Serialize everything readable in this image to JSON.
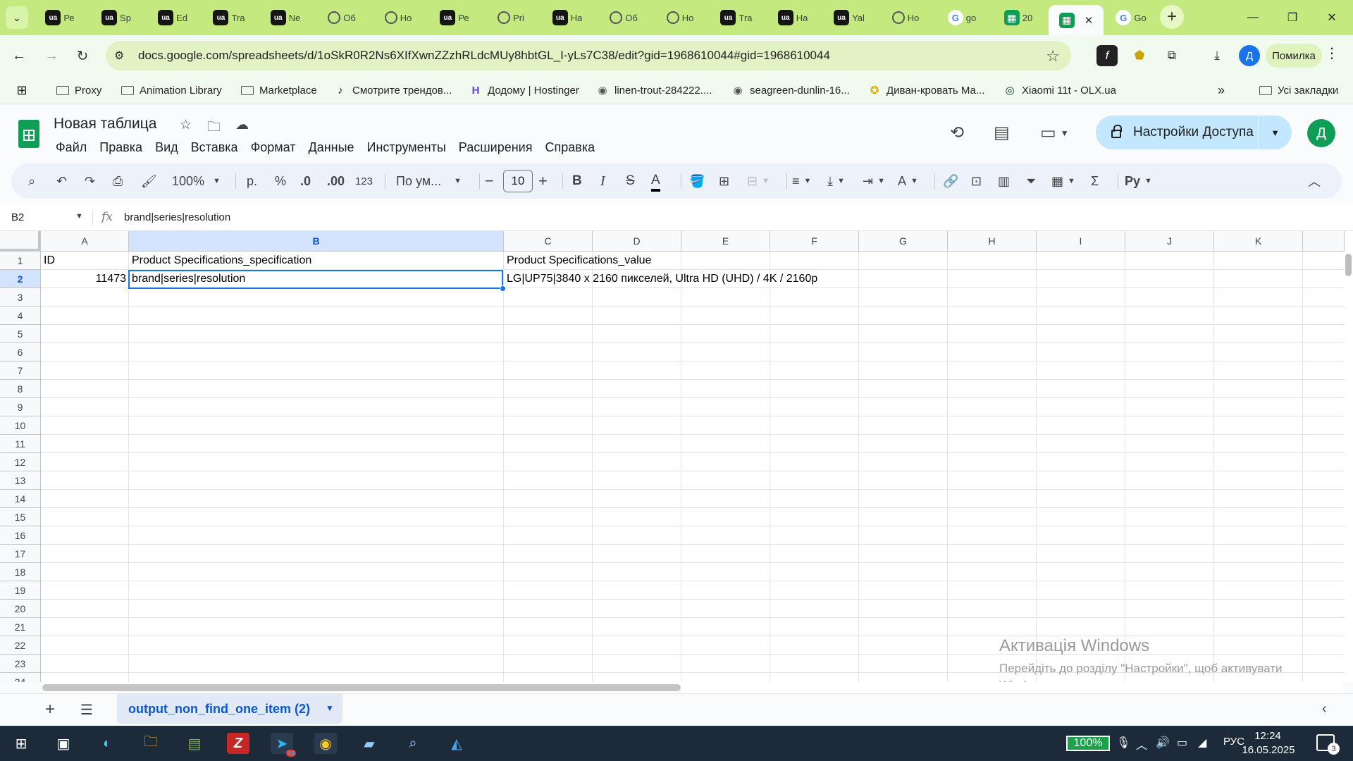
{
  "browser": {
    "tabs": [
      {
        "icon": "ua",
        "title": "Ре"
      },
      {
        "icon": "ua",
        "title": "Sp"
      },
      {
        "icon": "ua",
        "title": "Ed"
      },
      {
        "icon": "ua",
        "title": "Tra"
      },
      {
        "icon": "ua",
        "title": "Ne"
      },
      {
        "icon": "q",
        "title": "Об"
      },
      {
        "icon": "q",
        "title": "Но"
      },
      {
        "icon": "ua",
        "title": "Ре"
      },
      {
        "icon": "q",
        "title": "Pri"
      },
      {
        "icon": "ua",
        "title": "На"
      },
      {
        "icon": "q",
        "title": "Об"
      },
      {
        "icon": "q",
        "title": "Но"
      },
      {
        "icon": "ua",
        "title": "Tra"
      },
      {
        "icon": "ua",
        "title": "На"
      },
      {
        "icon": "ua",
        "title": "Yal"
      },
      {
        "icon": "q",
        "title": "Но"
      },
      {
        "icon": "g",
        "title": "go"
      },
      {
        "icon": "sheets",
        "title": "20"
      },
      {
        "icon": "sheets",
        "title": ""
      },
      {
        "icon": "g",
        "title": "Go"
      }
    ],
    "url": "docs.google.com/spreadsheets/d/1oSkR0R2Ns6XIfXwnZZzhRLdcMUy8hbtGL_I-yLs7C38/edit?gid=1968610044#gid=1968610044",
    "profile_letter": "Д",
    "error_label": "Помилка",
    "bookmarks": [
      {
        "icon": "folder",
        "label": "Proxy"
      },
      {
        "icon": "folder",
        "label": "Animation Library"
      },
      {
        "icon": "folder",
        "label": "Marketplace"
      },
      {
        "icon": "tiktok",
        "label": "Смотрите трендов..."
      },
      {
        "icon": "hostinger",
        "label": "Додому | Hostinger"
      },
      {
        "icon": "globe",
        "label": "linen-trout-284222...."
      },
      {
        "icon": "globe",
        "label": "seagreen-dunlin-16..."
      },
      {
        "icon": "medal",
        "label": "Диван-кровать Ма..."
      },
      {
        "icon": "olx",
        "label": "Xiaomi 11t - OLX.ua"
      }
    ],
    "all_bookmarks": "Усі закладки"
  },
  "sheets": {
    "title": "Новая таблица",
    "menus": [
      "Файл",
      "Правка",
      "Вид",
      "Вставка",
      "Формат",
      "Данные",
      "Инструменты",
      "Расширения",
      "Справка"
    ],
    "share_label": "Настройки Доступа",
    "account_letter": "Д",
    "toolbar": {
      "zoom": "100%",
      "currency": "р.",
      "percent": "%",
      "dec_decrease": ".0",
      "dec_increase": ".00",
      "number_format": "123",
      "font": "По ум...",
      "font_size": "10",
      "bold": "B",
      "italic": "I",
      "strike": "S",
      "text_color": "A"
    },
    "namebox": "B2",
    "fx_label": "fx",
    "formula": "brand|series|resolution",
    "columns": [
      "A",
      "B",
      "C",
      "D",
      "E",
      "F",
      "G",
      "H",
      "I",
      "J",
      "K"
    ],
    "selected_column": "B",
    "rows": [
      "1",
      "2",
      "3",
      "4",
      "5",
      "6",
      "7",
      "8",
      "9",
      "10",
      "11",
      "12",
      "13",
      "14",
      "15",
      "16",
      "17",
      "18",
      "19",
      "20",
      "21",
      "22",
      "23",
      "24"
    ],
    "selected_row": "2",
    "cells": {
      "A1": "ID",
      "B1": "Product Specifications_specification",
      "C1": "Product Specifications_value",
      "A2": "11473",
      "B2": "brand|series|resolution",
      "C2": "LG|UP75|3840 x 2160 пикселей, Ultra HD (UHD) / 4K / 2160p"
    },
    "sheet_tab": "output_non_find_one_item (2)",
    "watermark_title": "Активація Windows",
    "watermark_sub": "Перейдіть до розділу \"Настройки\", щоб активувати Windows."
  },
  "taskbar": {
    "battery": "100%",
    "lang": "РУС",
    "time": "12:24",
    "date": "16.05.2025",
    "notifications": "3",
    "telegram_badge": "94"
  },
  "colors": {
    "tabstrip": "#c3e97f",
    "accent": "#1a73e8",
    "sheets_green": "#0f9d58",
    "share_bg": "#c2e7ff"
  }
}
